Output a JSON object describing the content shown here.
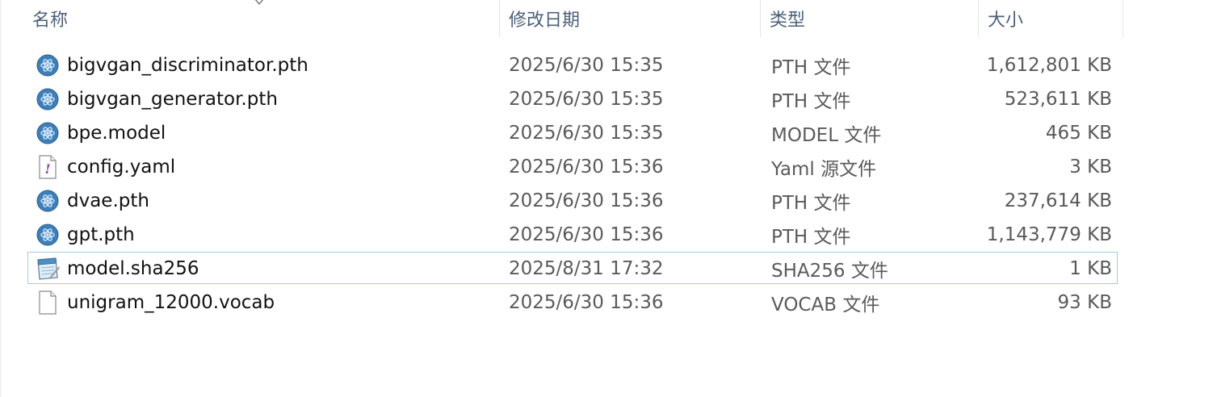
{
  "columns": {
    "name": "名称",
    "date": "修改日期",
    "type": "类型",
    "size": "大小"
  },
  "files": [
    {
      "name": "bigvgan_discriminator.pth",
      "date": "2025/6/30 15:35",
      "type": "PTH 文件",
      "size": "1,612,801 KB",
      "icon": "model-file-icon"
    },
    {
      "name": "bigvgan_generator.pth",
      "date": "2025/6/30 15:35",
      "type": "PTH 文件",
      "size": "523,611 KB",
      "icon": "model-file-icon"
    },
    {
      "name": "bpe.model",
      "date": "2025/6/30 15:35",
      "type": "MODEL 文件",
      "size": "465 KB",
      "icon": "model-file-icon"
    },
    {
      "name": "config.yaml",
      "date": "2025/6/30 15:36",
      "type": "Yaml 源文件",
      "size": "3 KB",
      "icon": "yaml-file-icon"
    },
    {
      "name": "dvae.pth",
      "date": "2025/6/30 15:36",
      "type": "PTH 文件",
      "size": "237,614 KB",
      "icon": "model-file-icon"
    },
    {
      "name": "gpt.pth",
      "date": "2025/6/30 15:36",
      "type": "PTH 文件",
      "size": "1,143,779 KB",
      "icon": "model-file-icon"
    },
    {
      "name": "model.sha256",
      "date": "2025/8/31 17:32",
      "type": "SHA256 文件",
      "size": "1 KB",
      "icon": "notepad-file-icon",
      "selected": true
    },
    {
      "name": "unigram_12000.vocab",
      "date": "2025/6/30 15:36",
      "type": "VOCAB 文件",
      "size": "93 KB",
      "icon": "blank-file-icon"
    }
  ]
}
